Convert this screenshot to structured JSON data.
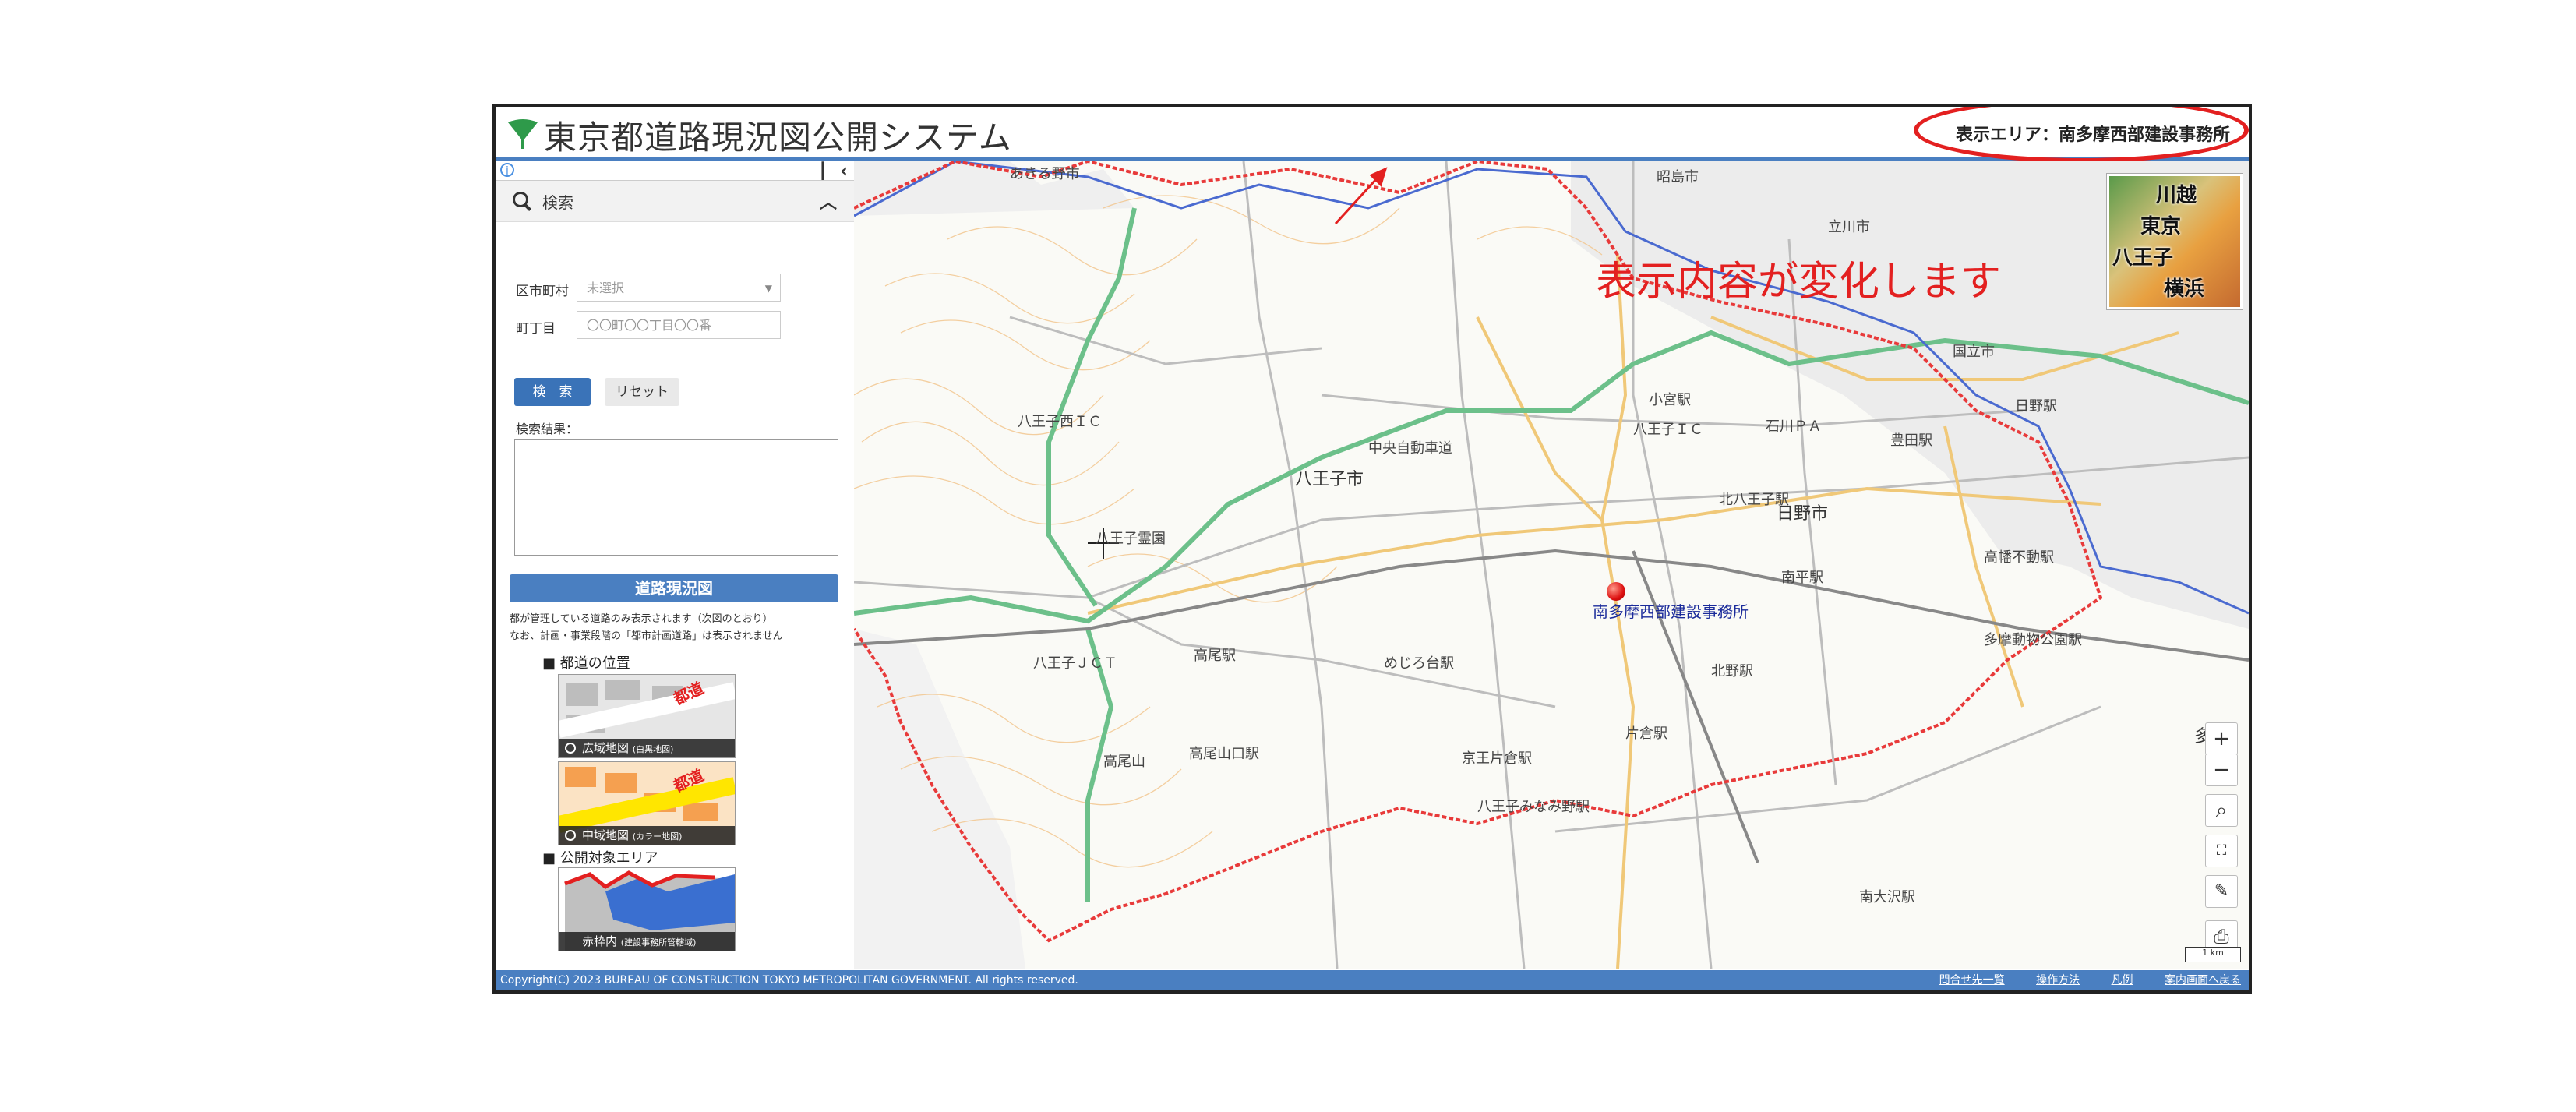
{
  "header": {
    "title": "東京都道路現況図公開システム",
    "area_label": "表示エリア：南多摩西部建設事務所"
  },
  "panel": {
    "search_title": "検索",
    "municipality_label": "区市町村",
    "municipality_value": "未選択",
    "town_label": "町丁目",
    "town_placeholder": "〇〇町〇〇丁目〇〇番",
    "search_button": "検　索",
    "reset_button": "リセット",
    "result_label": "検索結果：",
    "legend_title": "道路現況図",
    "note1": "都が管理している道路のみ表示されます（次図のとおり）",
    "note2": "なお、計画・事業段階の「都市計画道路」は表示されません",
    "section1": "■ 都道の位置",
    "thumb1_caption": "広域地図",
    "thumb1_sub": "(白黒地図)",
    "thumb2_caption": "中域地図",
    "thumb2_sub": "(カラー地図)",
    "thumb_road_label": "都道",
    "section2": "■ 公開対象エリア",
    "thumb3_caption": "赤枠内",
    "thumb3_sub": "(建設事務所管轄域)"
  },
  "map": {
    "callout": "表示内容が変化します",
    "office": "南多摩西部建設事務所",
    "places": [
      "八王子市",
      "日野市",
      "昭島市",
      "立川市",
      "国立市",
      "八王子西ＩＣ",
      "八王子ＪＣＴ",
      "八王子霊園",
      "高尾山",
      "高尾駅",
      "高尾山口駅",
      "めじろ台駅",
      "京王片倉駅",
      "片倉駅",
      "北野駅",
      "南平駅",
      "日野駅",
      "高幡不動駅",
      "多摩動物公園駅",
      "南大沢駅",
      "小宮駅",
      "中央自動車道",
      "八王子ＩＣ",
      "石川ＰＡ",
      "豊田駅",
      "北八王子駅",
      "八王子みなみ野駅",
      "多摩",
      "あきる野市"
    ],
    "inset_labels": [
      "東京",
      "川越",
      "八王子",
      "横浜"
    ],
    "controls": {
      "zoom_in": "+",
      "zoom_out": "−"
    },
    "scale": "1 km"
  },
  "footer": {
    "copyright": "Copyright(C) 2023 BUREAU OF CONSTRUCTION TOKYO METROPOLITAN GOVERNMENT. All rights reserved.",
    "links": [
      "問合せ先一覧",
      "操作方法",
      "凡例",
      "案内画面へ戻る"
    ]
  },
  "colors": {
    "header_blue": "#4a7fc1",
    "boundary_red": "#e32020",
    "road_green": "#6cc08a",
    "road_orange": "#f0c878"
  }
}
